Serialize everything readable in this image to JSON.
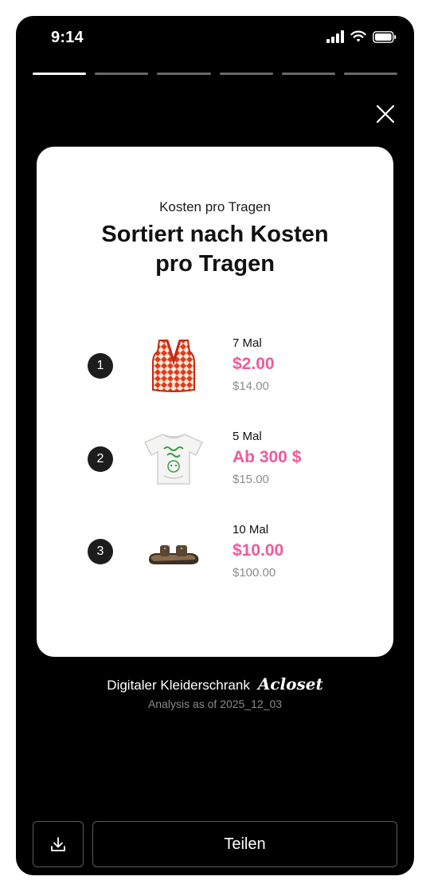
{
  "status_bar": {
    "time": "9:14"
  },
  "story_progress": {
    "total_segments": 6,
    "active_segment": 1
  },
  "card": {
    "subtitle": "Kosten pro Tragen",
    "title_line1": "Sortiert nach Kosten",
    "title_line2": "pro Tragen",
    "items": [
      {
        "rank": "1",
        "wear_count": "7 Mal",
        "cost_per_wear": "$2.00",
        "price": "$14.00",
        "image": "knit-vest"
      },
      {
        "rank": "2",
        "wear_count": "5 Mal",
        "cost_per_wear": "Ab 300 $",
        "price": "$15.00",
        "image": "graphic-tshirt"
      },
      {
        "rank": "3",
        "wear_count": "10 Mal",
        "cost_per_wear": "$10.00",
        "price": "$100.00",
        "image": "sandals"
      }
    ]
  },
  "footer": {
    "brand_text": "Digitaler Kleiderschrank",
    "brand_logo": "Acloset",
    "analysis_date": "Analysis as of 2025_12_03"
  },
  "actions": {
    "download_icon": "download-icon",
    "share_label": "Teilen"
  },
  "colors": {
    "accent_pink": "#ee5a9a",
    "background": "#000000",
    "card": "#ffffff"
  }
}
